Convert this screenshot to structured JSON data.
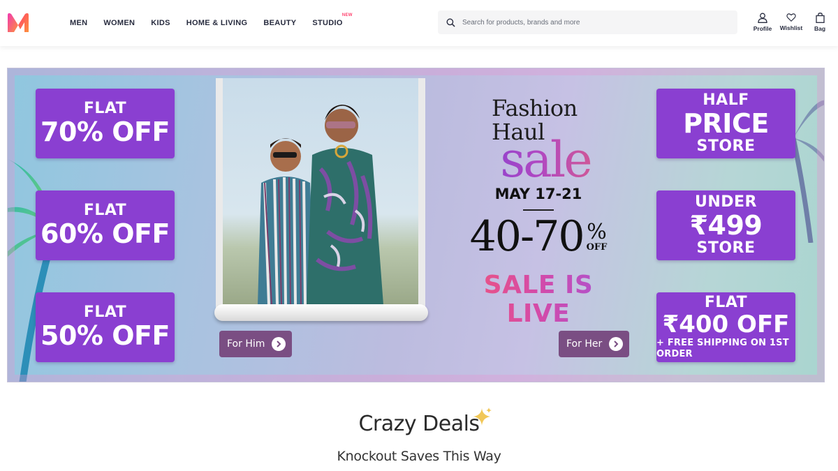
{
  "header": {
    "logo_name": "Myntra",
    "nav": [
      {
        "label": "MEN"
      },
      {
        "label": "WOMEN"
      },
      {
        "label": "KIDS"
      },
      {
        "label": "HOME & LIVING"
      },
      {
        "label": "BEAUTY"
      },
      {
        "label": "STUDIO",
        "badge": "NEW"
      }
    ],
    "search": {
      "placeholder": "Search for products, brands and more",
      "value": ""
    },
    "actions": [
      {
        "label": "Profile",
        "icon": "profile-icon"
      },
      {
        "label": "Wishlist",
        "icon": "heart-icon"
      },
      {
        "label": "Bag",
        "icon": "bag-icon"
      }
    ]
  },
  "banner": {
    "left_tiles": [
      {
        "line1": "FLAT",
        "line2": "70% OFF"
      },
      {
        "line1": "FLAT",
        "line2": "60% OFF"
      },
      {
        "line1": "FLAT",
        "line2": "50% OFF"
      }
    ],
    "right_tiles": [
      {
        "line1": "HALF",
        "line2": "PRICE",
        "line3": "STORE"
      },
      {
        "line1": "UNDER",
        "line2": "₹499",
        "line3": "STORE"
      },
      {
        "line1": "FLAT",
        "line2": "₹400 OFF",
        "line3": "+ FREE SHIPPING ON 1ST ORDER"
      }
    ],
    "buttons": {
      "him": "For Him",
      "her": "For Her"
    },
    "sale": {
      "title_line1": "Fashion",
      "title_line2": "Haul",
      "title_word": "sale",
      "dates": "MAY 17-21",
      "range": "40-70",
      "percent": "%",
      "off": "OFF",
      "status": "SALE IS LIVE"
    }
  },
  "deals": {
    "title": "Crazy Deals",
    "subtitle": "Knockout Saves This Way"
  },
  "colors": {
    "brand_pink": "#ff3f6c",
    "tile_purple": "#8a3fd1",
    "text_dark": "#282c3f"
  }
}
